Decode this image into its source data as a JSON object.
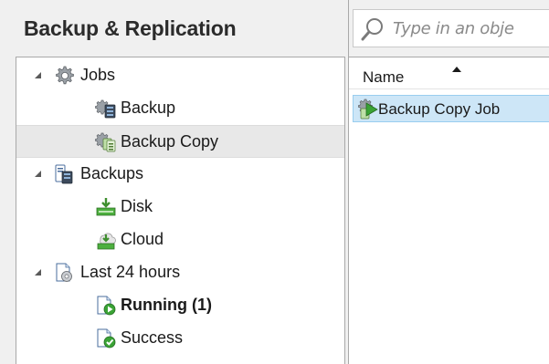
{
  "panel": {
    "title": "Backup & Replication"
  },
  "tree": {
    "jobs": {
      "label": "Jobs",
      "icon": "gear-icon"
    },
    "backup": {
      "label": "Backup",
      "icon": "backup-job-icon"
    },
    "backup_copy": {
      "label": "Backup Copy",
      "icon": "backup-copy-job-icon",
      "selected": true
    },
    "backups": {
      "label": "Backups",
      "icon": "backups-icon"
    },
    "disk": {
      "label": "Disk",
      "icon": "disk-icon"
    },
    "cloud": {
      "label": "Cloud",
      "icon": "cloud-icon"
    },
    "last24": {
      "label": "Last 24 hours",
      "icon": "sessions-icon"
    },
    "running": {
      "label": "Running (1)",
      "icon": "running-icon"
    },
    "success": {
      "label": "Success",
      "icon": "success-icon"
    }
  },
  "search": {
    "placeholder": "Type in an obje",
    "icon": "search-icon"
  },
  "list": {
    "columns": [
      "Name"
    ],
    "sort": "ascending",
    "rows": [
      {
        "name": "Backup Copy Job",
        "icon": "backup-copy-job-icon",
        "selected": true
      }
    ]
  },
  "colors": {
    "selection_fill": "#cde6f7",
    "selection_border": "#99cdef",
    "tree_selection": "#e8e8e8"
  }
}
